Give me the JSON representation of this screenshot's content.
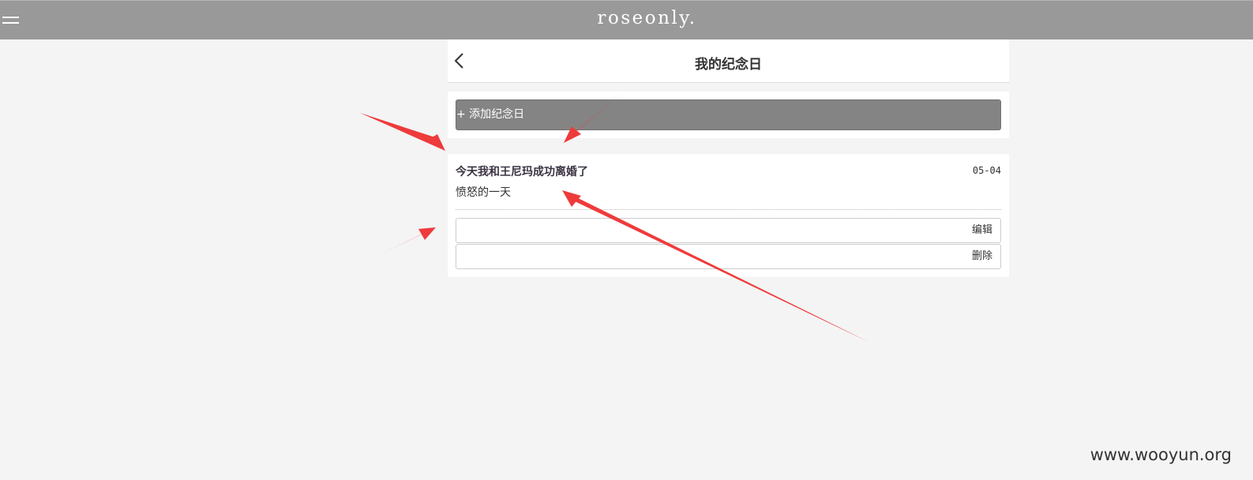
{
  "topbar": {
    "brand": "roseonly.",
    "menu_icon": "hamburger-menu-icon"
  },
  "header": {
    "title": "我的纪念日",
    "back_icon": "chevron-left-icon"
  },
  "add_button": {
    "label": "+ 添加纪念日"
  },
  "anniversary": {
    "title": "今天我和王尼玛成功离婚了",
    "date": "05-04",
    "description": "愤怒的一天",
    "edit_label": "编辑",
    "delete_label": "删除"
  },
  "watermark": "www.wooyun.org",
  "colors": {
    "topbar": "#999999",
    "add_button": "#848484",
    "arrow": "#ee3b3b",
    "background": "#f4f4f4"
  }
}
